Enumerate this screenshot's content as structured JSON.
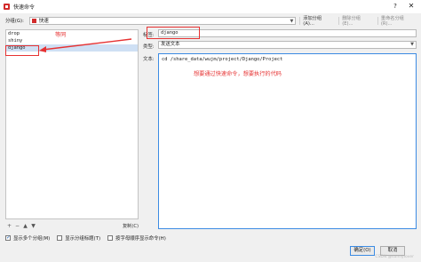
{
  "window": {
    "title": "快速命令",
    "help": "?",
    "close": "✕"
  },
  "group": {
    "label": "分组(G):",
    "selected": "快速",
    "buttons": [
      {
        "label": "添加分组(A)...",
        "disabled": false
      },
      {
        "label": "删除分组(E)...",
        "disabled": true
      },
      {
        "label": "重命名分组(R)...",
        "disabled": true
      }
    ]
  },
  "list": {
    "items": [
      "drop",
      "shiny",
      "django"
    ],
    "selected_index": 2
  },
  "list_toolbar": {
    "add": "+",
    "remove": "−",
    "up": "▲",
    "down": "▼",
    "copy": "复制(C)"
  },
  "form": {
    "title_label": "标签:",
    "title_value": "django",
    "type_label": "类型:",
    "type_value": "发送文本",
    "text_label": "文本:",
    "text_value": "cd /share_data/wujm/project/Django/Project"
  },
  "checkboxes": [
    {
      "label": "显示多个分组(M)",
      "checked": true
    },
    {
      "label": "显示分组标题(T)",
      "checked": false
    },
    {
      "label": "按字母顺序显示命令(H)",
      "checked": false
    }
  ],
  "dialog_buttons": {
    "ok": "确定(O)",
    "cancel": "取消"
  },
  "annotations": {
    "same": "等同",
    "note": "想要通过快速命令，想要执行的代码"
  },
  "watermark": "CSDN @sunnylover",
  "colors": {
    "annotation": "#e63232",
    "accent": "#3c8be3",
    "selection": "#cfe0f4"
  }
}
